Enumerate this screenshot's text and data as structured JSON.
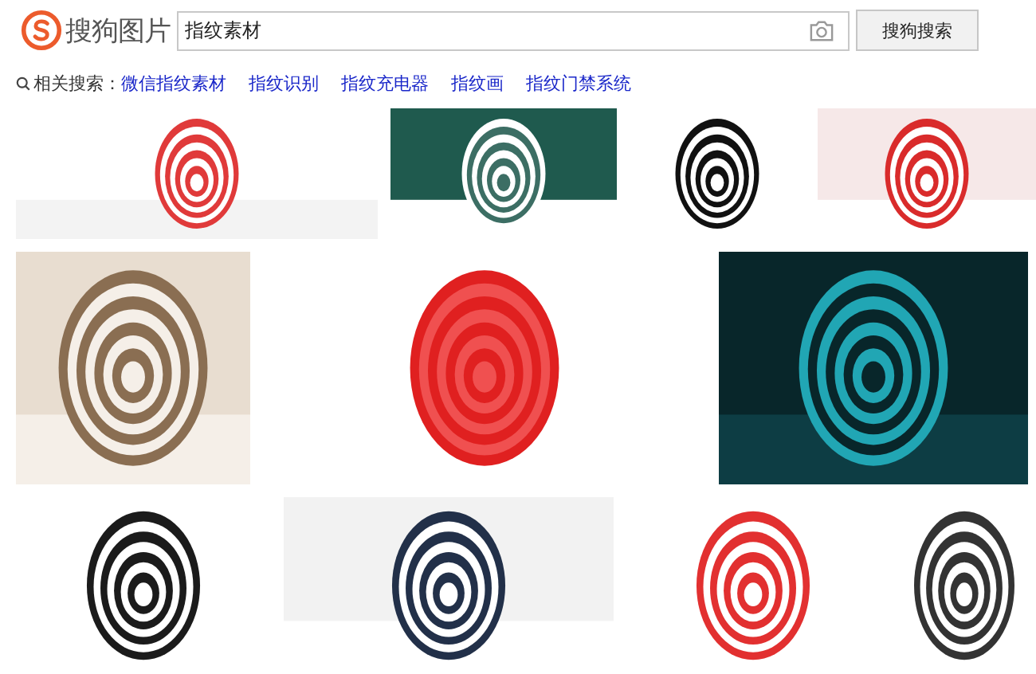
{
  "header": {
    "logo_text": "搜狗图片",
    "search": {
      "value": "指纹素材"
    },
    "search_button": "搜狗搜索"
  },
  "related": {
    "label": "相关搜索：",
    "links": [
      "微信指纹素材",
      "指纹识别",
      "指纹充电器",
      "指纹画",
      "指纹门禁系统"
    ]
  }
}
